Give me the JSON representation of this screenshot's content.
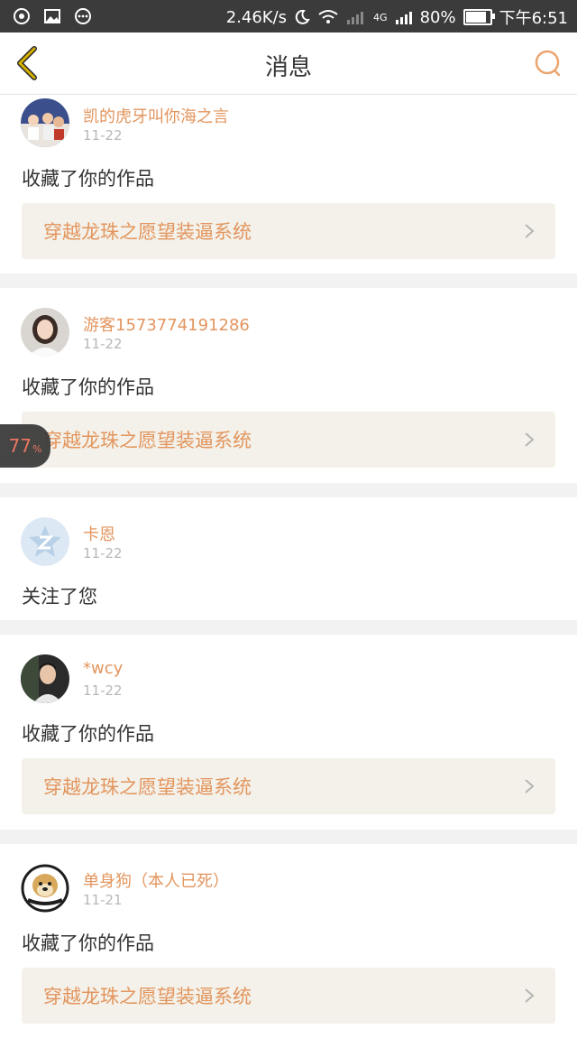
{
  "status_bar": {
    "speed": "2.46K/s",
    "network": "4G",
    "battery": "80%",
    "time": "下午6:51",
    "left_icons": [
      "browser-icon",
      "image-icon",
      "more-icon"
    ]
  },
  "nav": {
    "title": "消息"
  },
  "notifications": [
    {
      "name": "凯的虎牙叫你海之言",
      "time": "11-22",
      "action": "收藏了你的作品",
      "work": "穿越龙珠之愿望装逼系统",
      "avatar": "group-photo"
    },
    {
      "name": "游客1573774191286",
      "time": "11-22",
      "action": "收藏了你的作品",
      "work": "穿越龙珠之愿望装逼系统",
      "avatar": "woman-photo"
    },
    {
      "name": "卡恩",
      "time": "11-22",
      "action": "关注了您",
      "work": "",
      "avatar": "default-z"
    },
    {
      "name": "*wcy",
      "time": "11-22",
      "action": "收藏了你的作品",
      "work": "穿越龙珠之愿望装逼系统",
      "avatar": "man-photo"
    },
    {
      "name": "单身狗（本人已死）",
      "time": "11-21",
      "action": "收藏了你的作品",
      "work": "穿越龙珠之愿望装逼系统",
      "avatar": "doge"
    }
  ],
  "float_badge": {
    "value": "77",
    "unit": "%"
  },
  "colors": {
    "accent": "#e3955e",
    "status_bar": "#3b3b3b",
    "card_bg": "#f3f1e9",
    "back_icon": "#c9a000"
  }
}
